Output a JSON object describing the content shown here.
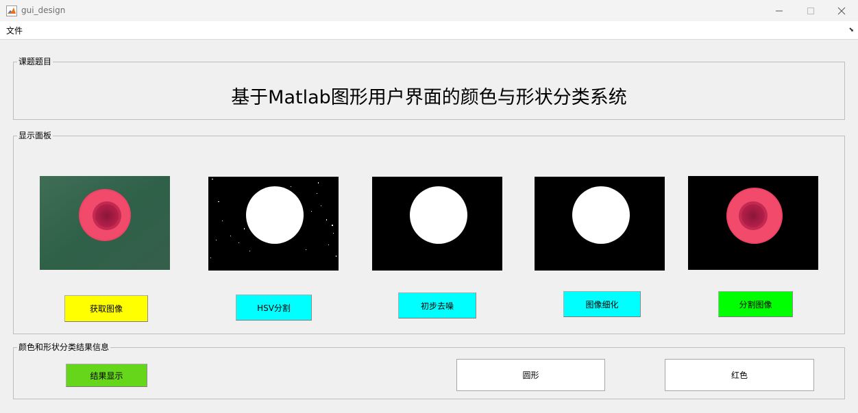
{
  "window": {
    "title": "gui_design"
  },
  "menu": {
    "file": "文件"
  },
  "title_panel": {
    "legend": "课题题目",
    "heading": "基于Matlab图形用户界面的颜色与形状分类系统"
  },
  "display_panel": {
    "legend": "显示面板",
    "buttons": [
      {
        "label": "获取图像",
        "color": "#ffff00"
      },
      {
        "label": "HSV分割",
        "color": "#00ffff"
      },
      {
        "label": "初步去噪",
        "color": "#00ffff"
      },
      {
        "label": "图像细化",
        "color": "#00ffff"
      },
      {
        "label": "分割图像",
        "color": "#00ff00"
      }
    ]
  },
  "result_panel": {
    "legend": "颜色和形状分类结果信息",
    "show_button": {
      "label": "结果显示",
      "color": "#66d61a"
    },
    "shape_result": "圆形",
    "color_result": "红色"
  }
}
